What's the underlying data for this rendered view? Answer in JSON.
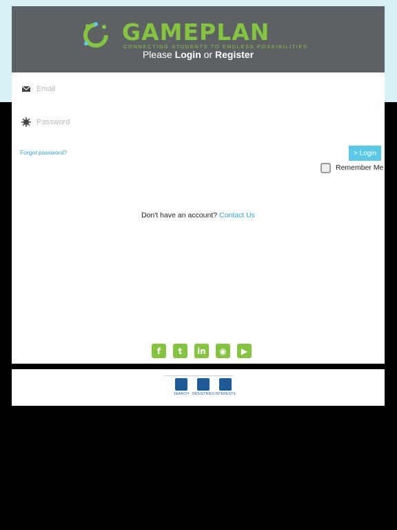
{
  "header": {
    "logo_text": "GAMEPLAN",
    "tagline": "CONNECTING STUDENTS TO ENDLESS POSSIBILITIES",
    "prompt_pre": "Please ",
    "prompt_login": "Login",
    "prompt_mid": " or ",
    "prompt_register": "Register"
  },
  "form": {
    "email_placeholder": "Email",
    "password_placeholder": "Password",
    "forgot_label": "Forgot password?",
    "login_label": "> Login",
    "remember_label": "Remember Me"
  },
  "signup": {
    "text": "Don't have an account? ",
    "link": "Contact Us"
  },
  "social": [
    {
      "name": "facebook-icon",
      "glyph": "f"
    },
    {
      "name": "twitter-icon",
      "glyph": "t"
    },
    {
      "name": "linkedin-icon",
      "glyph": "in"
    },
    {
      "name": "instagram-icon",
      "glyph": "◉"
    },
    {
      "name": "youtube-icon",
      "glyph": "▶"
    }
  ],
  "footer_nav": [
    {
      "label": "SEARCH",
      "icon": "wrench-icon"
    },
    {
      "label": "INDUSTRIES",
      "icon": "industry-icon"
    },
    {
      "label": "INTERESTS",
      "icon": "person-icon"
    }
  ],
  "colors": {
    "brand_green": "#84c441",
    "accent_blue": "#5bc8e8",
    "header_gray": "#5d6164",
    "nav_blue": "#1d5a96"
  }
}
